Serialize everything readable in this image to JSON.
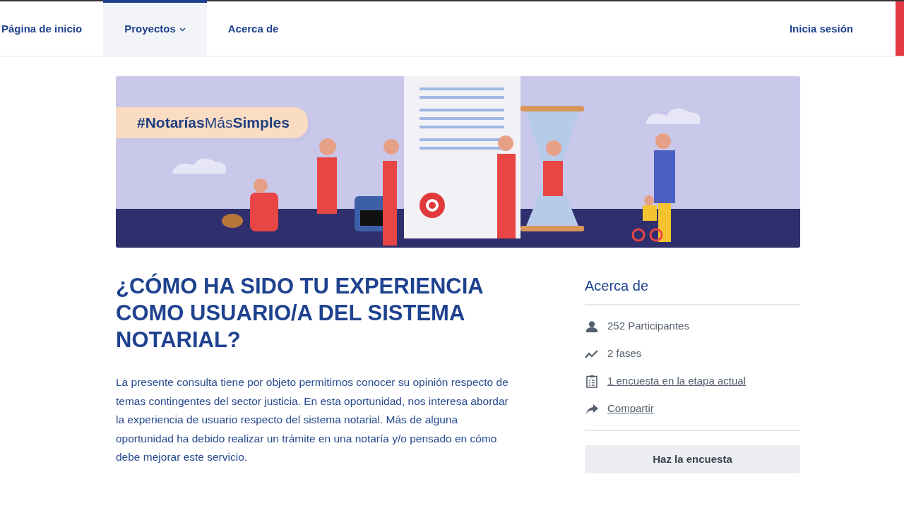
{
  "nav": {
    "items": [
      {
        "label": "Página de inicio",
        "selected": false,
        "dropdown": false
      },
      {
        "label": "Proyectos",
        "selected": true,
        "dropdown": true
      },
      {
        "label": "Acerca de",
        "selected": false,
        "dropdown": false
      }
    ],
    "login": "Inicia sesión"
  },
  "banner": {
    "hashtag": "**#Notarías**Más**Simples**"
  },
  "title": "¿CÓMO HA SIDO TU EXPERIENCIA COMO USUARIO/A DEL SISTEMA NOTARIAL?",
  "description": "La presente consulta tiene por objeto permitirnos conocer su opinión respecto de temas contingentes del sector justicia. En esta oportunidad, nos interesa abordar la experiencia de usuario respecto del sistema notarial. Más de alguna oportunidad ha debido realizar un trámite en una notaría y/o pensado en cómo debe mejorar este servicio.",
  "sidebar": {
    "title": "Acerca de",
    "items": [
      {
        "kind": "participants",
        "text": "252 Participantes",
        "link": false
      },
      {
        "kind": "phases",
        "text": "2 fases",
        "link": false
      },
      {
        "kind": "survey",
        "text": "1 encuesta en la etapa actual",
        "link": true
      },
      {
        "kind": "share",
        "text": "Compartir",
        "link": true
      }
    ],
    "button": "Haz la encuesta"
  }
}
